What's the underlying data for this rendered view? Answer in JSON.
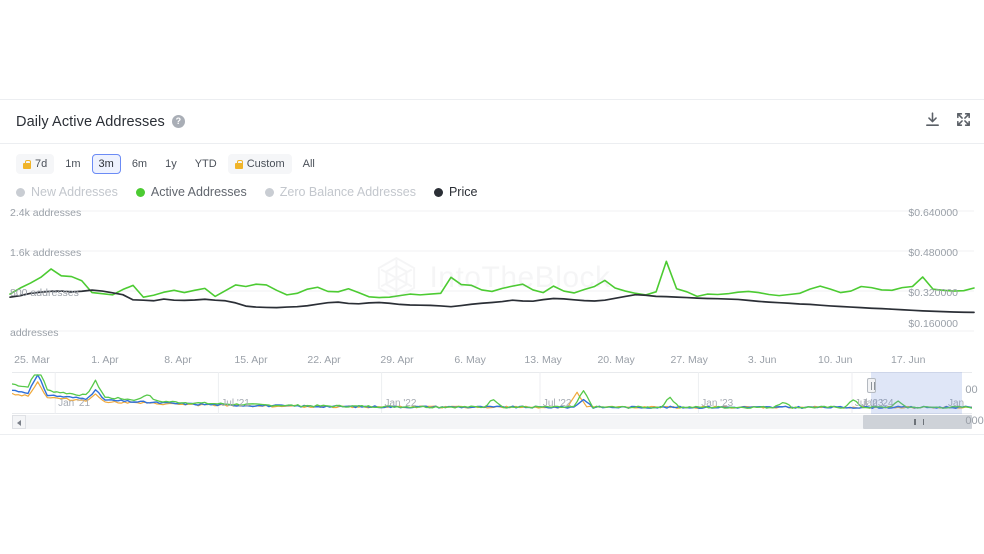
{
  "header": {
    "title": "Daily Active Addresses",
    "help_icon": "question-mark-icon",
    "download_icon": "download-icon",
    "expand_icon": "expand-icon"
  },
  "ranges": [
    {
      "label": "7d",
      "locked": true,
      "active": false
    },
    {
      "label": "1m",
      "locked": false,
      "active": false
    },
    {
      "label": "3m",
      "locked": false,
      "active": true
    },
    {
      "label": "6m",
      "locked": false,
      "active": false
    },
    {
      "label": "1y",
      "locked": false,
      "active": false
    },
    {
      "label": "YTD",
      "locked": false,
      "active": false
    },
    {
      "label": "Custom",
      "locked": true,
      "active": false
    },
    {
      "label": "All",
      "locked": false,
      "active": false
    }
  ],
  "legend": [
    {
      "label": "New Addresses",
      "color": "#c9cdd3",
      "enabled": false
    },
    {
      "label": "Active Addresses",
      "color": "#4ccb32",
      "enabled": true
    },
    {
      "label": "Zero Balance Addresses",
      "color": "#c9cdd3",
      "enabled": false
    },
    {
      "label": "Price",
      "color": "#2b2f36",
      "enabled": true
    }
  ],
  "watermark": {
    "text": "IntoTheBlock",
    "logo": "intotheblock-logo-icon"
  },
  "navigator": {
    "ticks": [
      "Jan '21",
      "Jul '21",
      "Jan '22",
      "Jul '22",
      "Jan '23",
      "Jul '23",
      "Jan '24",
      "Jan"
    ],
    "scroll_left_icon": "chevron-left-icon",
    "selection_label": "selected-range"
  },
  "ghost_labels": {
    "top": "00",
    "bottom": "000"
  },
  "chart_data": {
    "type": "line",
    "title": "Daily Active Addresses",
    "xlabel": "",
    "ylabel": "addresses",
    "y2label": "price",
    "grid": true,
    "legend_position": "top-left",
    "y_ticks_left": [
      "addresses",
      "800 addresses",
      "1.6k addresses",
      "2.4k addresses"
    ],
    "y_ticks_right": [
      "$0.160000",
      "$0.320000",
      "$0.480000",
      "$0.640000"
    ],
    "ylim": [
      0,
      3200
    ],
    "y2lim": [
      0.08,
      0.72
    ],
    "x_ticks": [
      "25. Mar",
      "1. Apr",
      "8. Apr",
      "15. Apr",
      "22. Apr",
      "29. Apr",
      "6. May",
      "13. May",
      "20. May",
      "27. May",
      "3. Jun",
      "10. Jun",
      "17. Jun"
    ],
    "x_start": "2024-03-25",
    "x_end": "2024-06-22",
    "series": [
      {
        "name": "Active Addresses",
        "color": "#4ccb32",
        "axis": "left",
        "unit": "addresses",
        "values": [
          1020,
          1180,
          1310,
          1460,
          1680,
          1500,
          1480,
          1370,
          1060,
          1030,
          1000,
          1140,
          1250,
          940,
          990,
          1070,
          1120,
          1060,
          1120,
          1170,
          960,
          1110,
          1260,
          1220,
          1280,
          1260,
          1120,
          1000,
          1040,
          1150,
          1200,
          1090,
          1080,
          1160,
          1060,
          950,
          930,
          940,
          980,
          1020,
          1000,
          1020,
          1040,
          1460,
          1270,
          1250,
          1130,
          1090,
          1170,
          1230,
          1280,
          1130,
          1060,
          1230,
          1100,
          1050,
          1140,
          1220,
          1380,
          1180,
          1100,
          1040,
          1000,
          1080,
          1880,
          1160,
          1080,
          960,
          1020,
          1010,
          1030,
          1070,
          1090,
          1060,
          1010,
          980,
          1010,
          1040,
          1150,
          1230,
          1150,
          1060,
          1100,
          1220,
          1190,
          1130,
          1120,
          1190,
          1220,
          1470,
          1150,
          1120,
          1100,
          1110,
          1180
        ]
      },
      {
        "name": "Price",
        "color": "#2b2f36",
        "axis": "right",
        "unit": "USD",
        "values": [
          0.268,
          0.276,
          0.288,
          0.294,
          0.299,
          0.3,
          0.296,
          0.299,
          0.305,
          0.3,
          0.291,
          0.281,
          0.254,
          0.252,
          0.249,
          0.258,
          0.252,
          0.251,
          0.253,
          0.257,
          0.252,
          0.249,
          0.238,
          0.221,
          0.216,
          0.214,
          0.213,
          0.216,
          0.218,
          0.223,
          0.231,
          0.239,
          0.242,
          0.235,
          0.233,
          0.238,
          0.24,
          0.236,
          0.23,
          0.227,
          0.226,
          0.225,
          0.222,
          0.218,
          0.224,
          0.231,
          0.236,
          0.24,
          0.245,
          0.252,
          0.248,
          0.247,
          0.255,
          0.261,
          0.259,
          0.254,
          0.25,
          0.248,
          0.252,
          0.262,
          0.272,
          0.281,
          0.278,
          0.272,
          0.271,
          0.268,
          0.266,
          0.263,
          0.261,
          0.26,
          0.258,
          0.256,
          0.251,
          0.246,
          0.242,
          0.239,
          0.236,
          0.232,
          0.23,
          0.226,
          0.222,
          0.219,
          0.216,
          0.213,
          0.21,
          0.208,
          0.205,
          0.202,
          0.199,
          0.196,
          0.194,
          0.192,
          0.19,
          0.189,
          0.188
        ]
      }
    ]
  },
  "nav_data": {
    "type": "line",
    "series": [
      {
        "name": "Active Addresses",
        "color": "#57c94a"
      },
      {
        "name": "New Addresses",
        "color": "#2f6fd8"
      },
      {
        "name": "Zero Balance Addresses",
        "color": "#f0a93b"
      }
    ],
    "selection_start_pct": 89.5,
    "selection_end_pct": 99.0
  }
}
